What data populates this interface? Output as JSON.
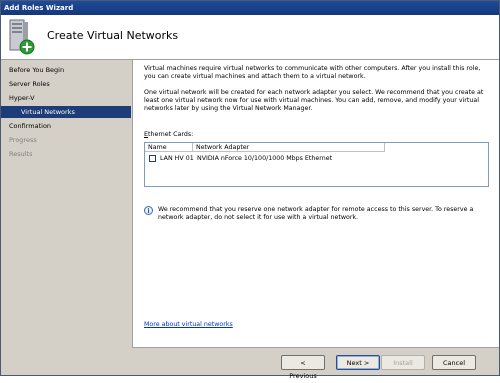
{
  "window": {
    "title": "Add Roles Wizard"
  },
  "header": {
    "title": "Create Virtual Networks",
    "icon": "server-add-icon"
  },
  "sidebar": {
    "items": [
      {
        "label": "Before You Begin",
        "state": "normal"
      },
      {
        "label": "Server Roles",
        "state": "normal"
      },
      {
        "label": "Hyper-V",
        "state": "normal"
      },
      {
        "label": "Virtual Networks",
        "state": "active"
      },
      {
        "label": "Confirmation",
        "state": "normal"
      },
      {
        "label": "Progress",
        "state": "dim"
      },
      {
        "label": "Results",
        "state": "dim"
      }
    ]
  },
  "main": {
    "paragraph1": "Virtual machines require virtual networks to communicate with other computers. After you install this role, you can create virtual machines and attach them to a virtual network.",
    "paragraph2": "One virtual network will be created for each network adapter you select. We recommend that you create at least one virtual network now for use with virtual machines. You can add, remove, and modify your virtual networks later by using the Virtual Network Manager.",
    "ethernet_label_access": "E",
    "ethernet_label_rest": "thernet Cards:",
    "table": {
      "columns": [
        "Name",
        "Network Adapter"
      ],
      "rows": [
        {
          "checked": false,
          "name": "LAN HV 01",
          "adapter": "NVIDIA nForce 10/100/1000 Mbps Ethernet"
        }
      ]
    },
    "info_text": "We recommend that you reserve one network adapter for remote access to this server. To reserve a network adapter, do not select it for use with a virtual network.",
    "link": "More about virtual networks"
  },
  "footer": {
    "previous": "< Previous",
    "next": "Next >",
    "install": "Install",
    "cancel": "Cancel"
  },
  "colors": {
    "active_nav": "#1e3c78",
    "title_bar": "#1e4b9a",
    "link": "#0033cc"
  }
}
